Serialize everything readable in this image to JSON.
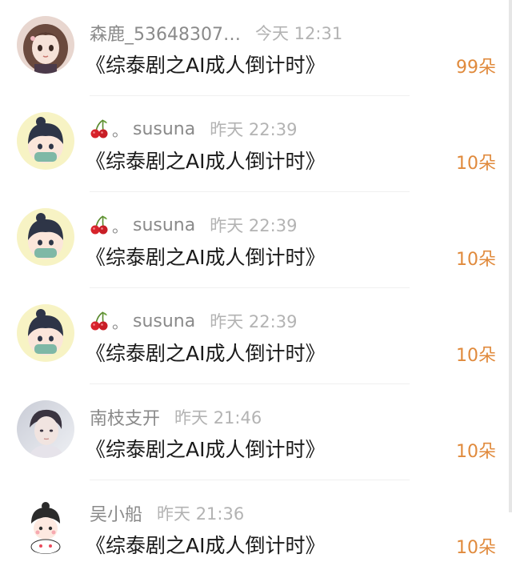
{
  "colors": {
    "amount": "#e08a3c",
    "username": "#8a8a8a",
    "time": "#b3b3b3",
    "title": "#1a1a1a"
  },
  "gifts": [
    {
      "username": "森鹿_53648307…",
      "has_cherry": false,
      "time": "今天 12:31",
      "title": "《综泰剧之AI成人倒计时》",
      "amount": "99朵",
      "avatar": "anime-girl-avatar"
    },
    {
      "username": "susuna",
      "prefix_icon": "cherry-icon",
      "dot": "。",
      "has_cherry": true,
      "time": "昨天 22:39",
      "title": "《综泰剧之AI成人倒计时》",
      "amount": "10朵",
      "avatar": "cartoon-boy-avatar"
    },
    {
      "username": "susuna",
      "prefix_icon": "cherry-icon",
      "dot": "。",
      "has_cherry": true,
      "time": "昨天 22:39",
      "title": "《综泰剧之AI成人倒计时》",
      "amount": "10朵",
      "avatar": "cartoon-boy-avatar"
    },
    {
      "username": "susuna",
      "prefix_icon": "cherry-icon",
      "dot": "。",
      "has_cherry": true,
      "time": "昨天 22:39",
      "title": "《综泰剧之AI成人倒计时》",
      "amount": "10朵",
      "avatar": "cartoon-boy-avatar"
    },
    {
      "username": "南枝支开",
      "has_cherry": false,
      "time": "昨天 21:46",
      "title": "《综泰剧之AI成人倒计时》",
      "amount": "10朵",
      "avatar": "photo-portrait-avatar"
    },
    {
      "username": "吴小船",
      "has_cherry": false,
      "time": "昨天 21:36",
      "title": "《综泰剧之AI成人倒计时》",
      "amount": "10朵",
      "avatar": "chibi-character-avatar"
    }
  ]
}
